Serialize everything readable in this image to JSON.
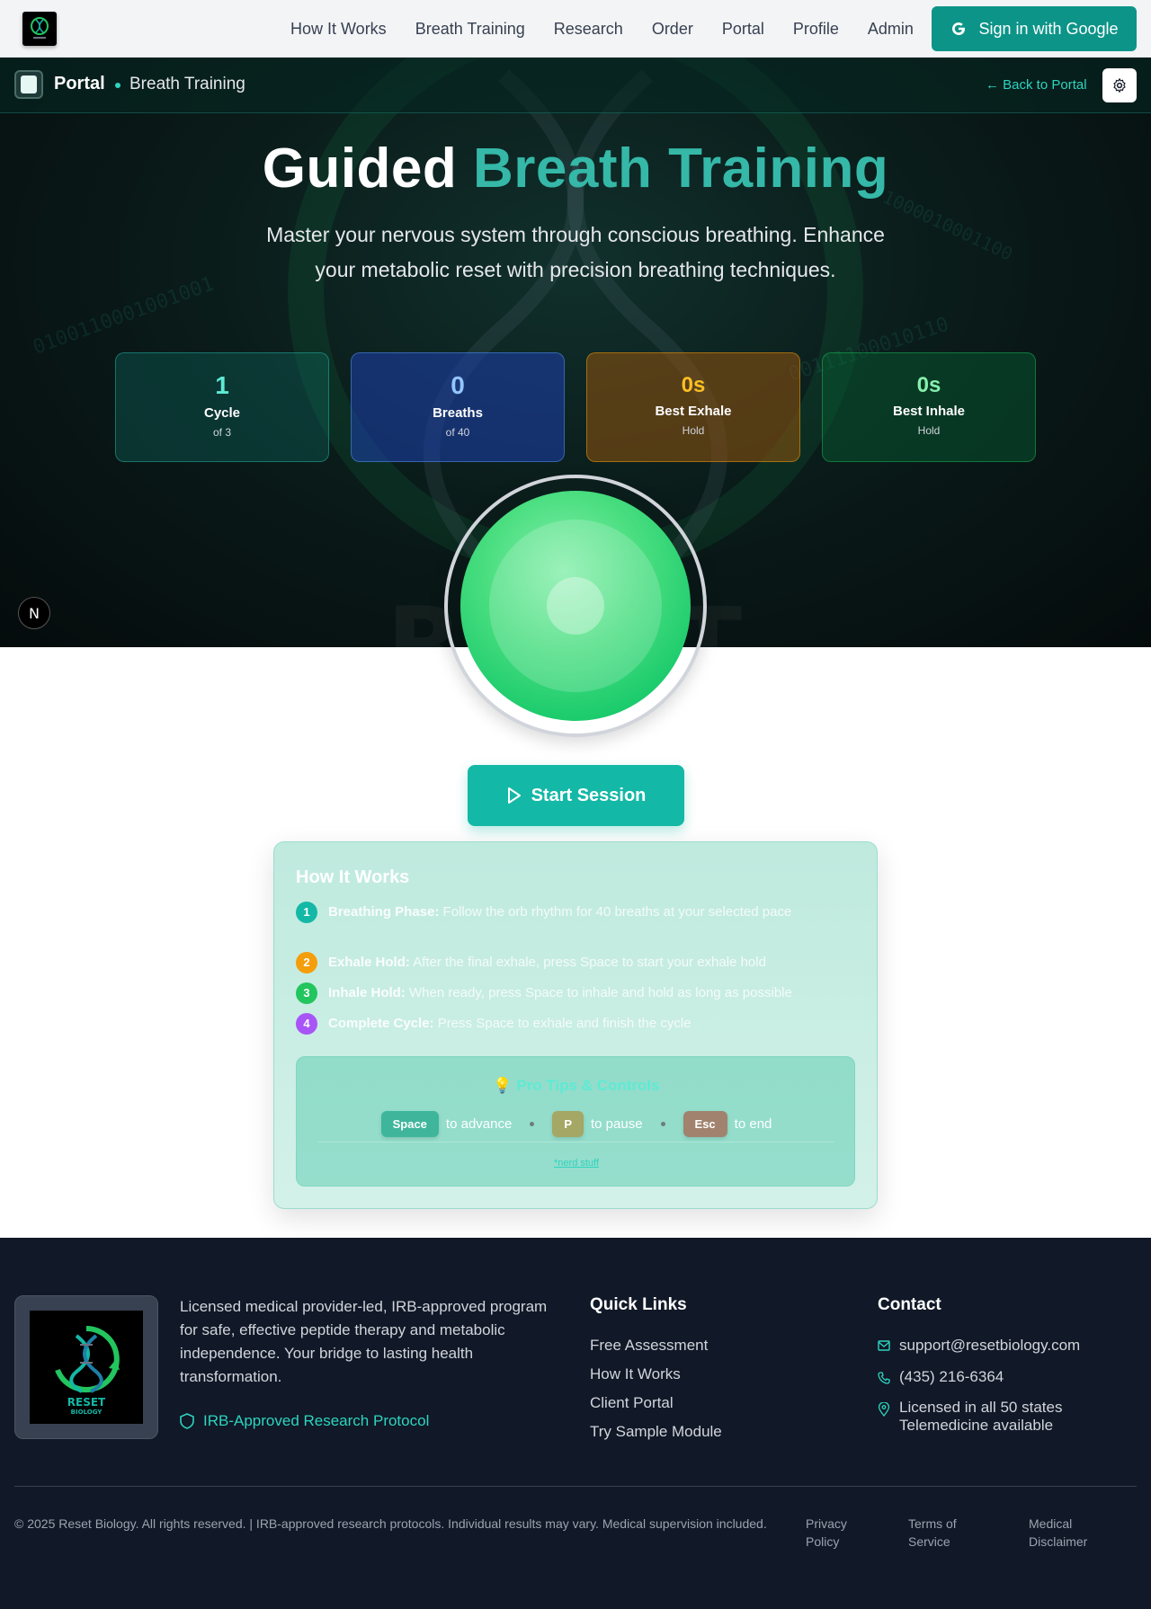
{
  "nav": {
    "links": [
      "How It Works",
      "Breath Training",
      "Research",
      "Order",
      "Portal",
      "Profile",
      "Admin"
    ],
    "signin_label": "Sign in with Google"
  },
  "portal_bar": {
    "title": "Portal",
    "subtitle": "Breath Training",
    "back_label": "← Back to Portal"
  },
  "hero": {
    "title_plain": "Guided",
    "title_accent": "Breath Training",
    "subtitle": "Master your nervous system through conscious breathing. Enhance your metabolic reset with precision breathing techniques."
  },
  "stats": [
    {
      "value": "1",
      "label": "Cycle",
      "sub": "of 3"
    },
    {
      "value": "0",
      "label": "Breaths",
      "sub": "of 40"
    },
    {
      "value": "0s",
      "label": "Best Exhale",
      "sub": "Hold"
    },
    {
      "value": "0s",
      "label": "Best Inhale",
      "sub": "Hold"
    }
  ],
  "badge_letter": "N",
  "start_label": "Start Session",
  "how": {
    "title": "How It Works",
    "steps": [
      {
        "num": "1",
        "bold": "Breathing Phase:",
        "text": "Follow the orb rhythm for 40 breaths at your selected pace"
      },
      {
        "num": "2",
        "bold": "Exhale Hold:",
        "text": "After the final exhale, press Space to start your exhale hold"
      },
      {
        "num": "3",
        "bold": "Inhale Hold:",
        "text": "When ready, press Space to inhale and hold as long as possible"
      },
      {
        "num": "4",
        "bold": "Complete Cycle:",
        "text": "Press Space to exhale and finish the cycle"
      }
    ],
    "tips_title": "💡 Pro Tips & Controls",
    "keys": [
      {
        "key": "Space",
        "action": "to advance"
      },
      {
        "key": "P",
        "action": "to pause"
      },
      {
        "key": "Esc",
        "action": "to end"
      }
    ],
    "nerd_link": "*nerd stuff"
  },
  "footer": {
    "description": "Licensed medical provider-led, IRB-approved program for safe, effective peptide therapy and metabolic independence. Your bridge to lasting health transformation.",
    "irb_label": "IRB-Approved Research Protocol",
    "quick_links_title": "Quick Links",
    "quick_links": [
      "Free Assessment",
      "How It Works",
      "Client Portal",
      "Try Sample Module"
    ],
    "contact_title": "Contact",
    "email": "support@resetbiology.com",
    "phone": "(435) 216-6364",
    "license_line1": "Licensed in all 50 states",
    "license_line2": "Telemedicine available",
    "copyright": "© 2025 Reset Biology. All rights reserved. | IRB-approved research protocols. Individual results may vary. Medical supervision included.",
    "legal_links": [
      "Privacy Policy",
      "Terms of Service",
      "Medical Disclaimer"
    ],
    "logo_text_1": "RESET",
    "logo_text_2": "BIOLOGY"
  },
  "colors": {
    "brand_teal": "#0d9488",
    "accent_teal": "#14b8a6",
    "orb_green": "#22c55e",
    "footer_bg": "#111827"
  }
}
